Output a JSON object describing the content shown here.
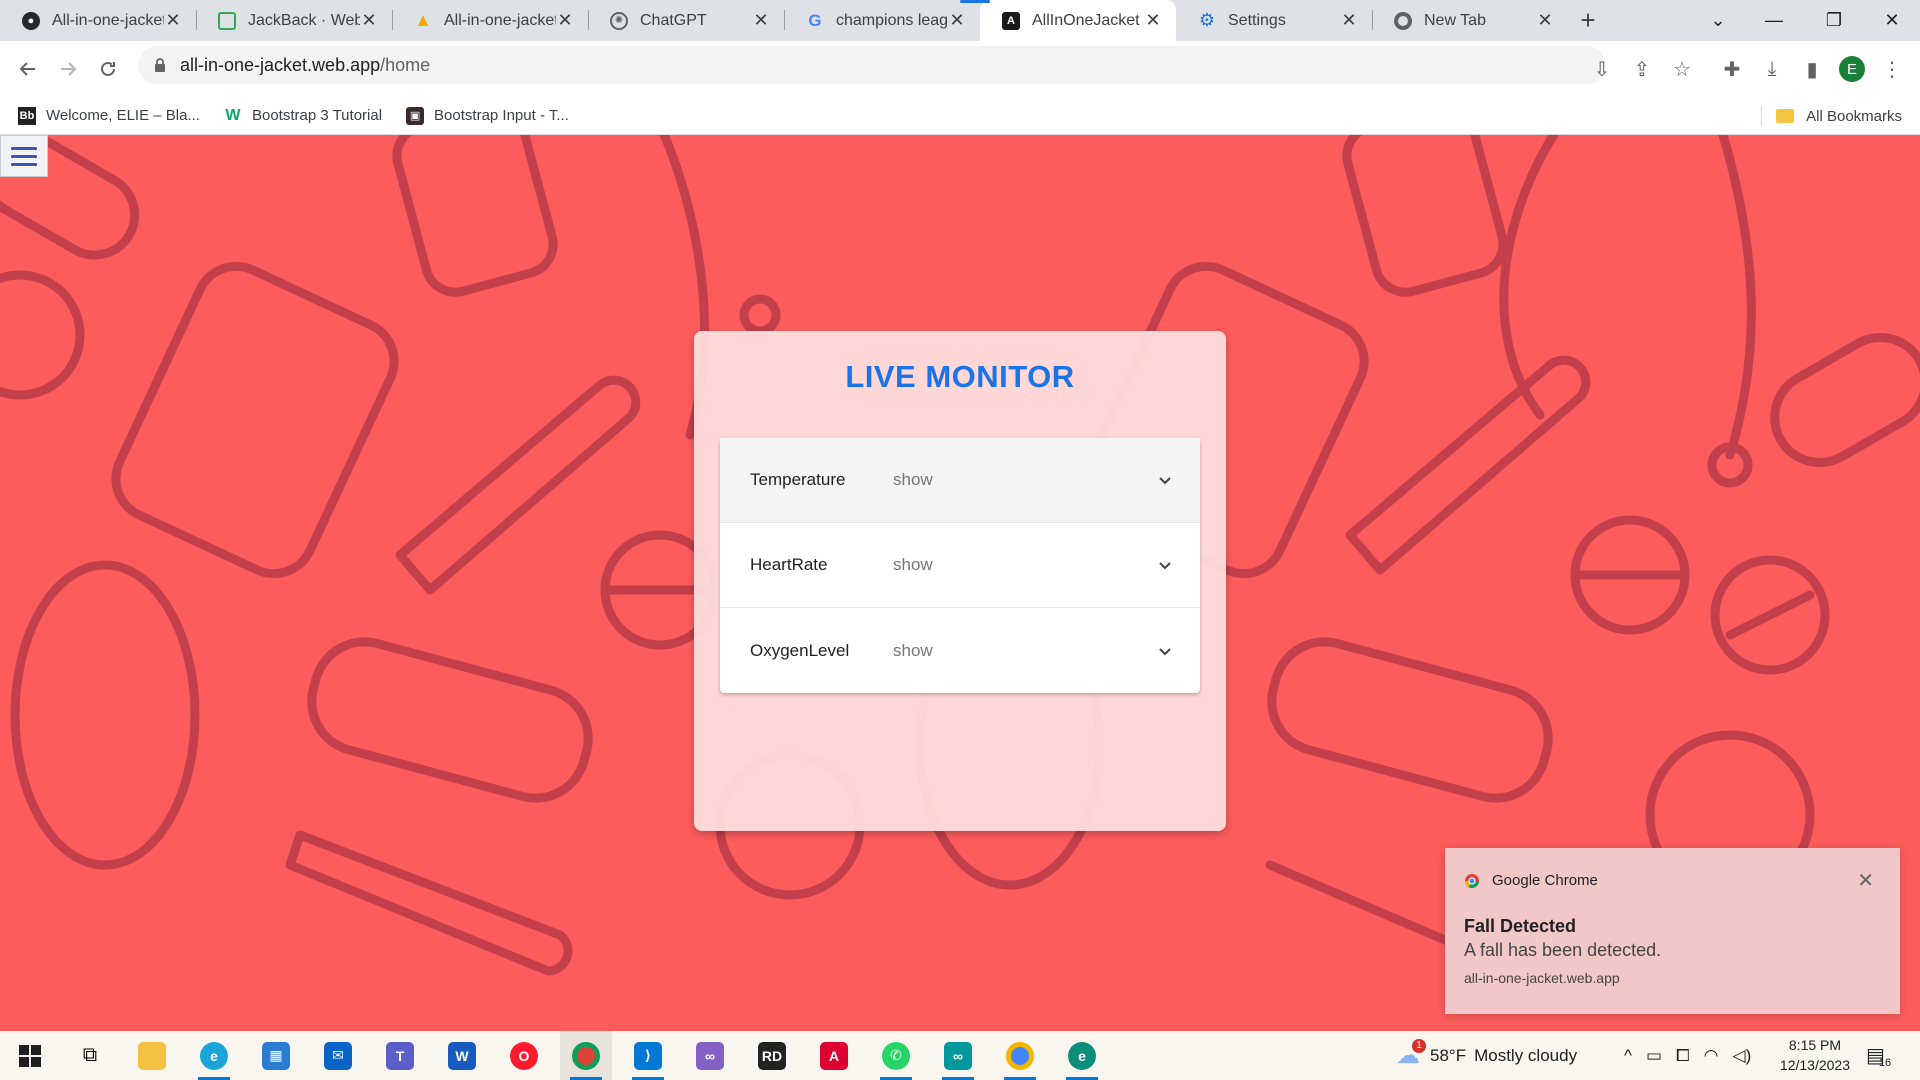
{
  "browser": {
    "tabs": [
      {
        "title": "All-in-one-jacket",
        "icon": "github-icon"
      },
      {
        "title": "JackBack · Web S",
        "icon": "jackback-icon"
      },
      {
        "title": "All-in-one-jacket",
        "icon": "firebase-icon"
      },
      {
        "title": "ChatGPT",
        "icon": "chatgpt-icon"
      },
      {
        "title": "champions leagu",
        "icon": "google-icon"
      },
      {
        "title": "AllInOneJacket",
        "icon": "angular-icon",
        "active": true
      },
      {
        "title": "Settings",
        "icon": "gear-icon"
      },
      {
        "title": "New Tab",
        "icon": "chrome-icon"
      }
    ],
    "address": {
      "host": "all-in-one-jacket.web.app",
      "path": "/home"
    },
    "profile_initial": "E",
    "bookmarks": [
      {
        "label": "Welcome, ELIE – Bla...",
        "icon": "blackboard-icon"
      },
      {
        "label": "Bootstrap 3 Tutorial",
        "icon": "w3schools-icon"
      },
      {
        "label": "Bootstrap Input - T...",
        "icon": "tutorial-icon"
      }
    ],
    "all_bookmarks_label": "All Bookmarks"
  },
  "page": {
    "title": "LIVE MONITOR",
    "accordion": [
      {
        "title": "Temperature",
        "description": "show"
      },
      {
        "title": "HeartRate",
        "description": "show"
      },
      {
        "title": "OxygenLevel",
        "description": "show"
      }
    ],
    "colors": {
      "background": "#fd5c5c",
      "title": "#1a73e8",
      "card": "#ffe1e1"
    }
  },
  "notification": {
    "app": "Google Chrome",
    "title": "Fall Detected",
    "body": "A fall has been detected.",
    "source": "all-in-one-jacket.web.app"
  },
  "taskbar": {
    "weather": {
      "temp": "58°F",
      "condition": "Mostly cloudy",
      "alert_count": "1"
    },
    "time": "8:15 PM",
    "date": "12/13/2023",
    "notification_count": "16"
  }
}
